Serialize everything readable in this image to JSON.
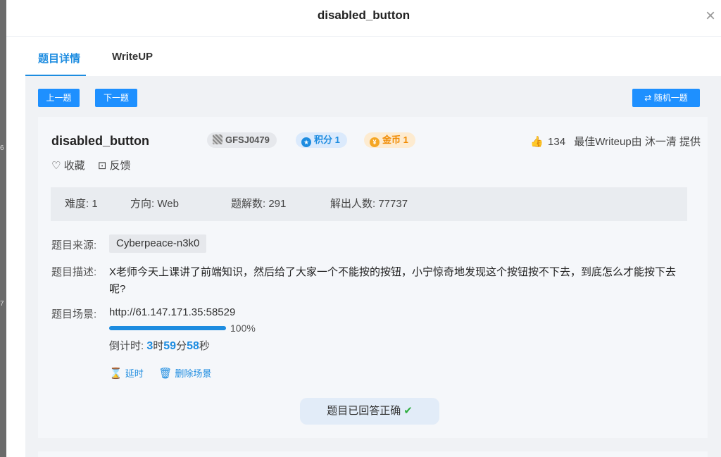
{
  "backdrop": {
    "frag1": "6",
    "frag2": "7"
  },
  "modal": {
    "title": "disabled_button",
    "close_glyph": "×"
  },
  "tabs": [
    {
      "label": "题目详情"
    },
    {
      "label": "WriteUP"
    }
  ],
  "nav": {
    "prev_label": "上一题",
    "next_label": "下一题",
    "random_label": "随机一题"
  },
  "challenge": {
    "name": "disabled_button",
    "id_badge": "GFSJ0479",
    "score_badge": "积分 1",
    "coin_badge": "金币 1",
    "likes": "134",
    "best_writeup": "最佳Writeup由 沐一清 提供",
    "favorite_label": "收藏",
    "feedback_label": "反馈"
  },
  "stats": {
    "difficulty": "难度: 1",
    "direction": "方向: Web",
    "solves": "题解数: 291",
    "solvers": "解出人数: 77737"
  },
  "source": {
    "label": "题目来源:",
    "value": "Cyberpeace-n3k0"
  },
  "description": {
    "label": "题目描述:",
    "text": "X老师今天上课讲了前端知识，然后给了大家一个不能按的按钮，小宁惊奇地发现这个按钮按不下去，到底怎么才能按下去呢?"
  },
  "scene": {
    "label": "题目场景:",
    "url": "http://61.147.171.35:58529",
    "progress": 100,
    "progress_text": "100%",
    "countdown_prefix": "倒计时: ",
    "hours": "3",
    "hours_unit": "时",
    "minutes": "59",
    "minutes_unit": "分",
    "seconds": "58",
    "seconds_unit": "秒",
    "extend_label": "延时",
    "delete_label": "删除场景"
  },
  "status": {
    "answered_label": "题目已回答正确",
    "check": "✔"
  },
  "icons": {
    "close": "close-icon",
    "random": "shuffle-icon",
    "like": "thumbs-up-icon",
    "favorite": "heart-icon",
    "feedback": "feedback-icon",
    "extend": "hourglass-icon",
    "delete": "trash-icon"
  },
  "colors": {
    "accent": "#1d8ce0",
    "button": "#1e90ff",
    "coin": "#f08a00",
    "success": "#2dad3e"
  }
}
